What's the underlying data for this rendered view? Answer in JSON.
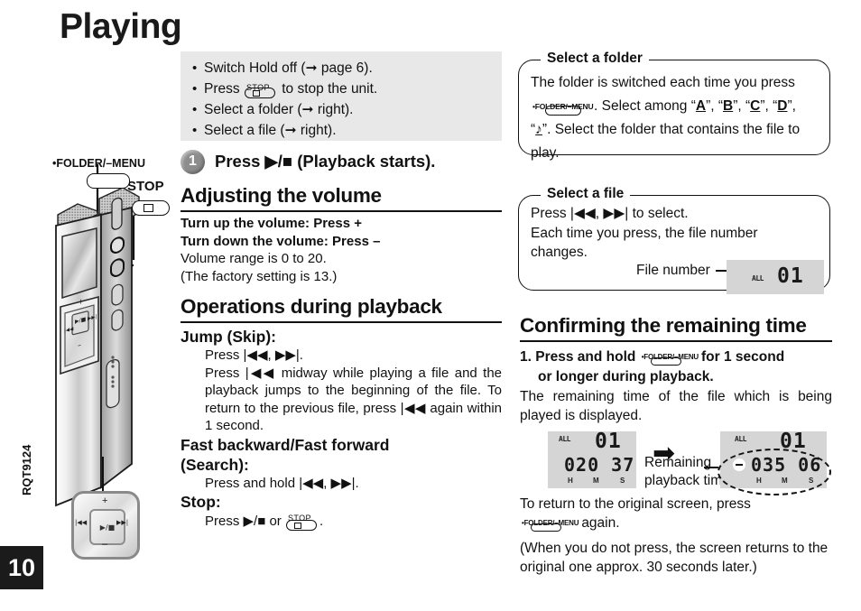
{
  "page": {
    "title": "Playing",
    "spine_code": "RQT9124",
    "page_number": "10"
  },
  "left_column": {
    "callout_folder_menu": "•FOLDER/–MENU",
    "callout_stop": "STOP",
    "dpad": {
      "plus": "+",
      "minus": "–",
      "prev": "|◀◀",
      "next": "▶▶|",
      "play_stop": "▶/■"
    }
  },
  "preparation": {
    "bullets": [
      "Switch Hold off (➞ page 6).",
      "Press  to stop the unit.",
      "Select a folder (➞ right).",
      "Select a file (➞ right)."
    ],
    "bullet_1_text": "Switch Hold off (",
    "bullet_1_arrow": "➞",
    "bullet_1_tail": " page 6).",
    "bullet_2_pre": "Press",
    "bullet_2_post": "to stop the unit.",
    "bullet_3": "Select a folder (➞ right).",
    "bullet_4": "Select a file (➞ right).",
    "stop_glyph_label": "STOP"
  },
  "step_one": {
    "number": "1",
    "text": "Press ▶/■ (Playback starts)."
  },
  "adjusting_volume": {
    "heading": "Adjusting the volume",
    "line_up": "Turn up the volume: Press +",
    "line_down": "Turn down the volume: Press –",
    "line_range": "Volume range is 0 to 20.",
    "line_factory": "(The factory setting is 13.)"
  },
  "operations": {
    "heading": "Operations during playback",
    "jump": {
      "label": "Jump (Skip):",
      "line1": "Press |◀◀, ▶▶|.",
      "line2": "Press |◀◀ midway while playing a file and the playback jumps to the beginning of the file. To return to the previous file, press |◀◀ again within 1 second."
    },
    "search": {
      "label_line1": "Fast backward/Fast forward",
      "label_line2": "(Search):",
      "line1_pre": "Press and hold |◀◀, ▶▶|."
    },
    "stop": {
      "label": "Stop:",
      "line_pre": "Press ▶/■ or",
      "line_post": "."
    }
  },
  "select_folder": {
    "legend": "Select a folder",
    "text_pre": "The folder is switched each time you press",
    "button_label": "•FOLDER/–MENU",
    "text_mid": ". Select among “",
    "folder_a": "A",
    "folder_b": "B",
    "folder_c": "C",
    "folder_d": "D",
    "folder_music": "♪",
    "text_post": "”. Select the folder that contains the file to play.",
    "full_text": "The folder is switched each time you press •FOLDER/–MENU . Select among “A”, “B”, “C”, “D”, “♪”. Select the folder that contains the file to play."
  },
  "select_file": {
    "legend": "Select a file",
    "line1": "Press |◀◀, ▶▶| to select.",
    "line2": "Each time you press, the file number changes.",
    "file_number_label": "File number",
    "lcd": {
      "all": "ALL",
      "number": "01"
    }
  },
  "confirming_remaining_time": {
    "heading": "Confirming the remaining time",
    "step_number": "1.",
    "step_text_pre": "Press and hold",
    "button_label": "•FOLDER/–MENU",
    "step_text_post": "for 1 second",
    "step_text_line2": "or longer during playback.",
    "body1": "The remaining time of the file which is being played is displayed.",
    "caption_remaining_line1": "Remaining",
    "caption_remaining_line2": "playback time",
    "arrow": "➡",
    "lcd_before": {
      "all": "ALL",
      "file_number": "01",
      "time": "020 37",
      "h": "H",
      "m": "M",
      "s": "S"
    },
    "lcd_after": {
      "all": "ALL",
      "file_number": "01",
      "minus": "–",
      "time": "035 06",
      "h": "H",
      "m": "M",
      "s": "S"
    },
    "body2_pre": "To return to the original screen, press",
    "body2_post": "again.",
    "body3": "(When you do not press, the screen returns to the original one approx. 30 seconds later.)"
  },
  "colors": {
    "prep_box_bg": "#e8e8e8",
    "lcd_bg": "#d5d5d5",
    "page_number_bg": "#1b1b1b",
    "text": "#111111"
  }
}
